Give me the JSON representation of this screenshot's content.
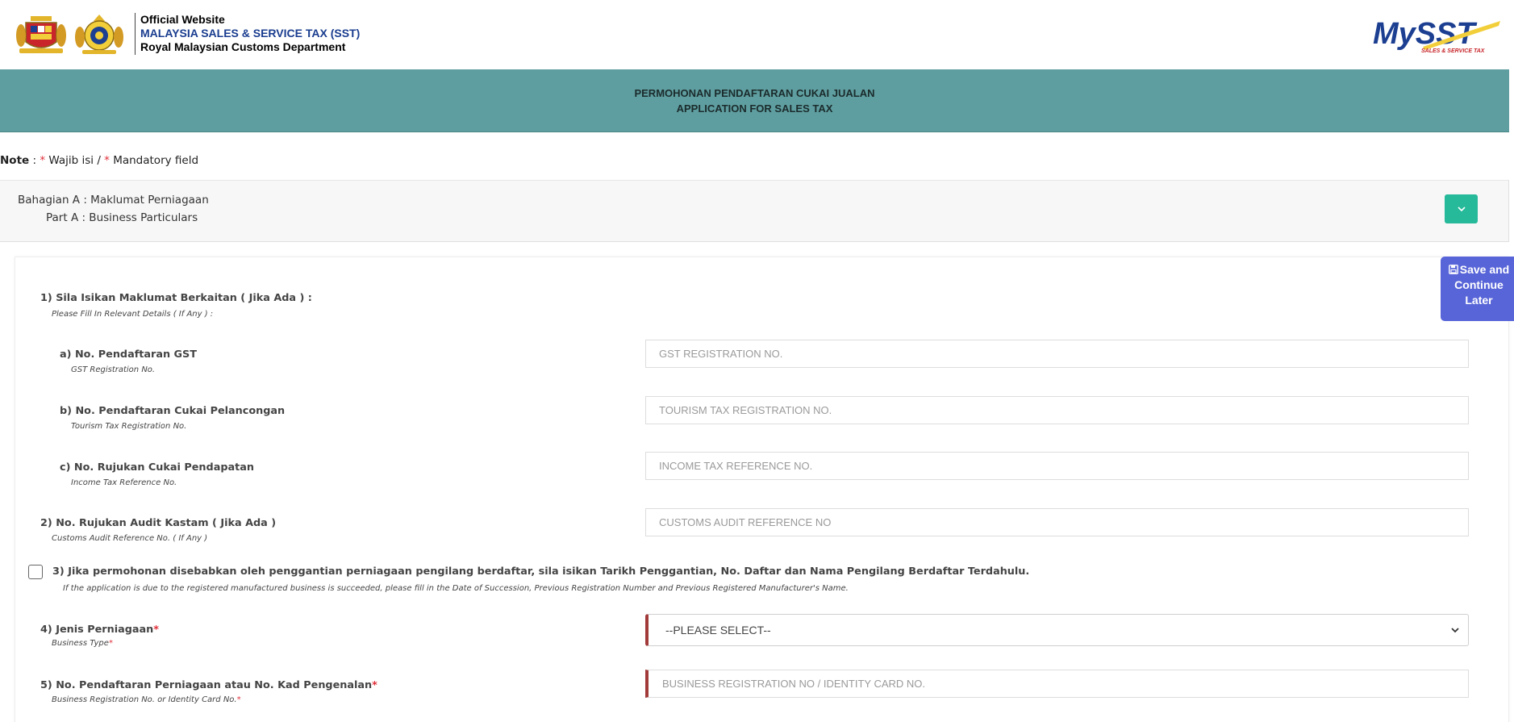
{
  "header": {
    "line1": "Official Website",
    "line2": "MALAYSIA SALES & SERVICE TAX (SST)",
    "line3": "Royal Malaysian Customs Department",
    "logo_text": "MySST",
    "logo_tagline": "SALES & SERVICE TAX",
    "colors": {
      "line2": "#1a3d8f"
    }
  },
  "title": {
    "line1": "PERMOHONAN PENDAFTARAN CUKAI JUALAN",
    "line2": "APPLICATION FOR SALES TAX",
    "color": "#5f9ea0"
  },
  "note": {
    "label": "Note",
    "sep": " : ",
    "star": "*",
    "malay": " Wajib isi / ",
    "english": " Mandatory field"
  },
  "section": {
    "title_my": "Bahagian A : Maklumat Perniagaan",
    "title_en": "Part A : Business Particulars",
    "toggle_icon": "chevron-down-icon",
    "accent": "#26b99a"
  },
  "save_later": {
    "line1": "Save and",
    "line2": "Continue",
    "line3": "Later",
    "icon": "floppy-disk-icon",
    "color": "#5865d8"
  },
  "form": {
    "q1": {
      "label": "1) Sila Isikan Maklumat Berkaitan ( Jika Ada ) :",
      "sub": "Please Fill In Relevant Details ( If Any ) :"
    },
    "q1a": {
      "label": "a) No. Pendaftaran GST",
      "sub": "GST Registration No.",
      "placeholder": "GST REGISTRATION NO."
    },
    "q1b": {
      "label": "b) No. Pendaftaran Cukai Pelancongan",
      "sub": "Tourism Tax Registration No.",
      "placeholder": "TOURISM TAX REGISTRATION NO."
    },
    "q1c": {
      "label": "c) No. Rujukan Cukai Pendapatan",
      "sub": "Income Tax Reference No.",
      "placeholder": "INCOME TAX REFERENCE NO."
    },
    "q2": {
      "label": "2) No. Rujukan Audit Kastam ( Jika Ada )",
      "sub": "Customs Audit Reference No. ( If Any )",
      "placeholder": "CUSTOMS AUDIT REFERENCE NO"
    },
    "q3": {
      "label": "3) Jika permohonan disebabkan oleh penggantian perniagaan pengilang berdaftar, sila isikan Tarikh Penggantian, No. Daftar dan Nama Pengilang Berdaftar Terdahulu.",
      "sub": "If the application is due to the registered manufactured business is succeeded, please fill in the Date of Succession, Previous Registration Number and Previous Registered Manufacturer's Name."
    },
    "q4": {
      "label": "4) Jenis Perniagaan",
      "sub": "Business Type",
      "selected": "--PLEASE SELECT--"
    },
    "q5": {
      "label": "5) No. Pendaftaran Perniagaan atau No. Kad Pengenalan",
      "sub": "Business Registration No. or Identity Card No.",
      "placeholder": "BUSINESS REGISTRATION NO / IDENTITY CARD NO."
    },
    "required_mark": "*",
    "required_color": "#a33a3a"
  }
}
